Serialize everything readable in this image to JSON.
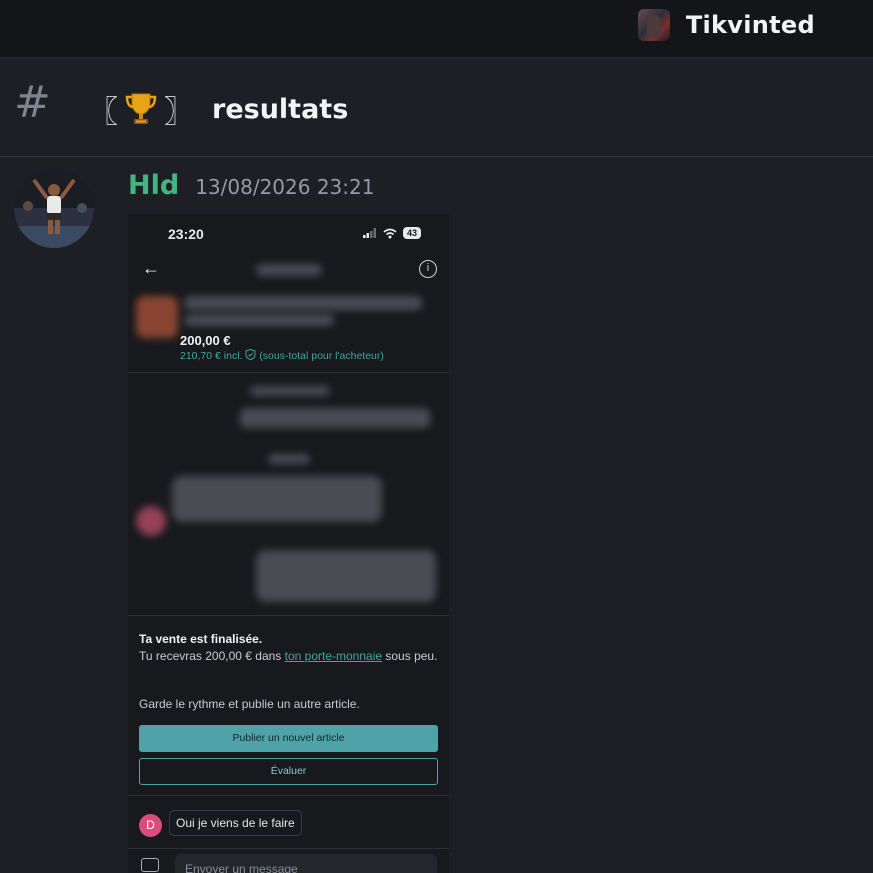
{
  "topbar": {
    "server_name": "Tikvinted"
  },
  "channel": {
    "hash": "#",
    "bracket_left": "〖",
    "emoji": "🏆",
    "bracket_right": "〗",
    "name": "resultats"
  },
  "message": {
    "author": "Hld",
    "author_color": "#43b581",
    "timestamp": "13/08/2026 23:21",
    "attachment": {
      "status_time": "23:20",
      "battery": "43",
      "price": "200,00 €",
      "price_incl": "210,70 € incl.",
      "price_incl_note": "(sous-total pour l'acheteur)",
      "sale_title": "Ta vente est finalisée.",
      "sale_text_before": "Tu recevras 200,00 € dans ",
      "sale_link": "ton porte-monnaie",
      "sale_text_after": " sous peu.",
      "keep_text": "Garde le rythme et publie un autre article.",
      "publish_button": "Publier un nouvel article",
      "evaluate_button": "Évaluer",
      "reply_avatar_letter": "D",
      "reply_text": "Oui je viens de le faire",
      "composer_placeholder": "Envoyer un message",
      "accent_color": "#4fa3a8"
    }
  },
  "icons": [
    "hash-icon",
    "server-icon",
    "trophy-icon",
    "back-arrow-icon",
    "info-icon",
    "camera-icon",
    "wifi-icon",
    "signal-icon",
    "shield-icon"
  ]
}
